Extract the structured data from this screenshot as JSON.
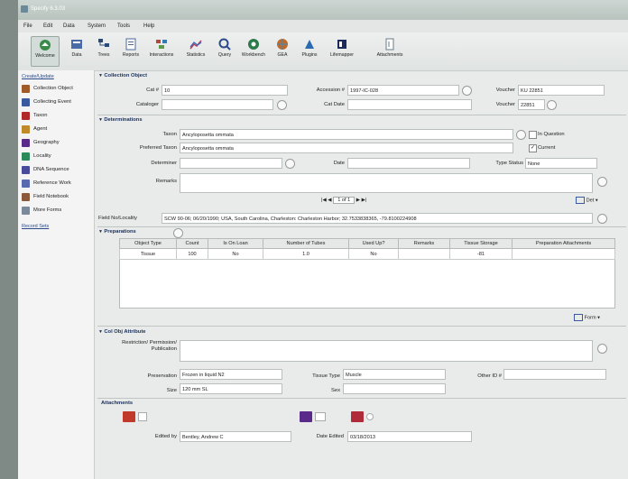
{
  "window": {
    "title": "Specify 6.3.03"
  },
  "menu": [
    "File",
    "Edit",
    "Data",
    "System",
    "Tools",
    "Help"
  ],
  "toolbar": [
    {
      "label": "Welcome",
      "icon": "home-icon",
      "color": "#3a8a4a"
    },
    {
      "label": "Data",
      "icon": "data-icon",
      "color": "#4a6aa8"
    },
    {
      "label": "Trees",
      "icon": "tree-icon",
      "color": "#2a4a7a"
    },
    {
      "label": "Reports",
      "icon": "reports-icon",
      "color": "#4a6a9a"
    },
    {
      "label": "Interactions",
      "icon": "interactions-icon",
      "color": "#b04a3a"
    },
    {
      "label": "Statistics",
      "icon": "statistics-icon",
      "color": "#b03a6a"
    },
    {
      "label": "Query",
      "icon": "query-icon",
      "color": "#2a4a8a"
    },
    {
      "label": "Workbench",
      "icon": "workbench-icon",
      "color": "#2a7a4a"
    },
    {
      "label": "GEA",
      "icon": "gea-icon",
      "color": "#c06a2a"
    },
    {
      "label": "Plugins",
      "icon": "plugins-icon",
      "color": "#2a6ab0"
    },
    {
      "label": "Lifemapper",
      "icon": "lifemapper-icon",
      "color": "#1a2a5a"
    },
    {
      "label": "Attachments",
      "icon": "attachments-icon",
      "color": "#6a7a8a"
    }
  ],
  "sidebar": {
    "header": "Create/Update",
    "items": [
      {
        "label": "Collection Object",
        "color": "#a05a2a"
      },
      {
        "label": "Collecting Event",
        "color": "#3a5aa0"
      },
      {
        "label": "Taxon",
        "color": "#b02a2a"
      },
      {
        "label": "Agent",
        "color": "#c08a2a"
      },
      {
        "label": "Geography",
        "color": "#5a2a8a"
      },
      {
        "label": "Locality",
        "color": "#2a8a5a"
      },
      {
        "label": "DNA Sequence",
        "color": "#4a4a9a"
      },
      {
        "label": "Reference Work",
        "color": "#5a6ab0"
      },
      {
        "label": "Field Notebook",
        "color": "#8a5a3a"
      },
      {
        "label": "More Forms",
        "color": "#7a8a9a"
      }
    ],
    "footer": "Record Sets"
  },
  "collection_object": {
    "section": "Collection Object",
    "cat_label": "Cat #",
    "cat_value": "10",
    "accession_label": "Accession #",
    "accession_value": "1997-IC-028",
    "voucher_label": "Voucher",
    "voucher_value": "KU 22851",
    "cataloger_label": "Cataloger",
    "cataloger_value": "",
    "catdate_label": "Cat Date",
    "catdate_value": "",
    "voucher2_label": "Voucher",
    "voucher2_value": "22851"
  },
  "determinations": {
    "section": "Determinations",
    "taxon_label": "Taxon",
    "taxon_value": "Ancyloposetta ommata",
    "in_question": "In Question",
    "preferred_label": "Preferred Taxon",
    "preferred_value": "Ancyloposetta ommata",
    "current": "Current",
    "determiner_label": "Determiner",
    "determiner_value": "",
    "date_label": "Date",
    "date_value": "",
    "type_status_label": "Type Status",
    "type_status_value": "None",
    "remarks_label": "Remarks",
    "remarks_value": "",
    "pager": "1 of 1",
    "det_button": "Det"
  },
  "field_locality": {
    "label": "Field No/Locality",
    "value": "SCW 90-06; 06/20/1990; USA, South Carolina, Charleston: Charleston Harbor; 32.7533838365, -79.8100224908"
  },
  "preparations": {
    "section": "Preparations",
    "columns": [
      "Object Type",
      "Count",
      "Is On Loan",
      "Number of Tubes",
      "Used Up?",
      "Remarks",
      "Tissue Storage",
      "Preparation Attachments"
    ],
    "rows": [
      [
        "Tissue",
        "100",
        "No",
        "1.0",
        "No",
        "",
        "-81",
        ""
      ]
    ],
    "form_button": "Form"
  },
  "col_obj_attributes": {
    "section": "Col Obj Attribute",
    "restriction_label": "Restriction/ Permission/ Publication",
    "restriction_value": "",
    "preservation_label": "Preservation",
    "preservation_value": "Frozen in liquid N2",
    "tissue_label": "Tissue Type",
    "tissue_value": "Muscle",
    "otherid_label": "Other ID #",
    "otherid_value": "",
    "size_label": "Size",
    "size_value": "120 mm SL",
    "sex_label": "Sex",
    "sex_value": ""
  },
  "attachments": {
    "section": "Attachments"
  },
  "audit": {
    "edited_by_label": "Edited by",
    "edited_by_value": "Bentley, Andrew C",
    "date_edited_label": "Date Edited",
    "date_edited_value": "03/18/2013"
  }
}
